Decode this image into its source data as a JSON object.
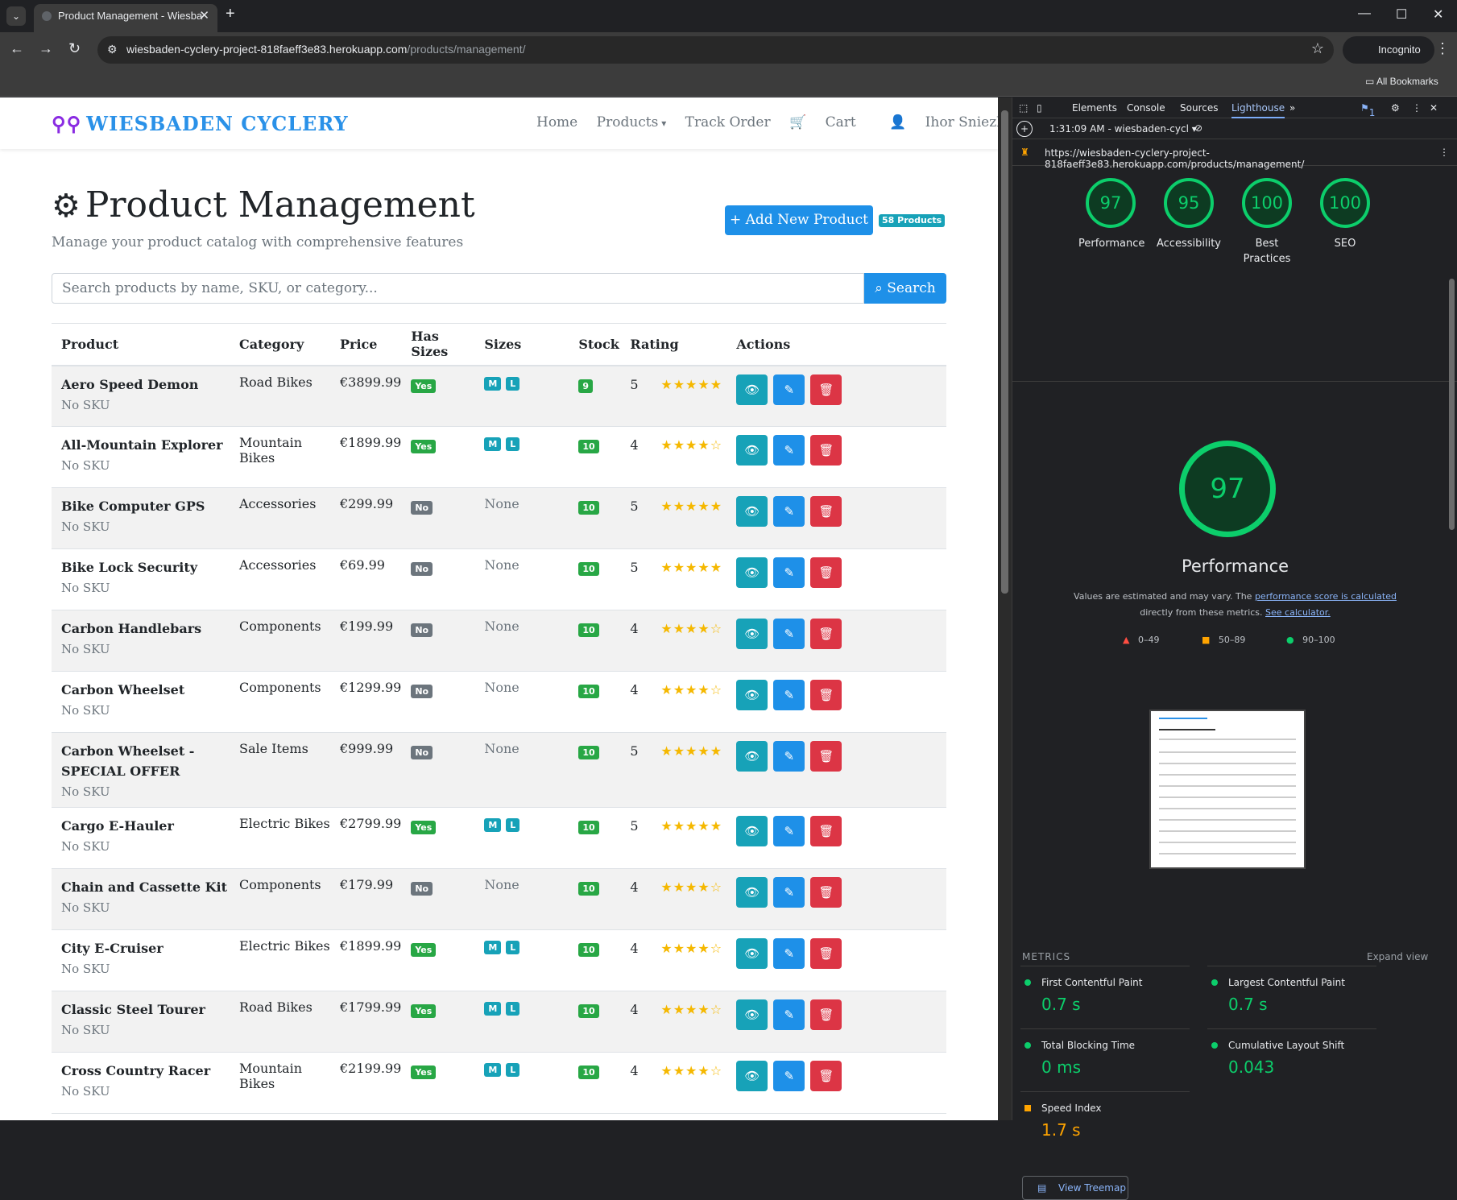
{
  "browser": {
    "tab_title": "Product Management - Wiesba",
    "url_host": "wiesbaden-cyclery-project-818faeff3e83.herokuapp.com",
    "url_path": "/products/management/",
    "incognito_label": "Incognito",
    "bookmarks_label": "All Bookmarks"
  },
  "site": {
    "brand": "WIESBADEN CYCLERY",
    "nav": [
      "Home",
      "Products",
      "Track Order",
      "Cart",
      "Ihor Sniezhko"
    ]
  },
  "header": {
    "title": "Product Management",
    "subtitle": "Manage your product catalog with comprehensive features",
    "add_button": "Add New Product",
    "count_badge": "58 Products"
  },
  "search": {
    "placeholder": "Search products by name, SKU, or category...",
    "button": "Search"
  },
  "table": {
    "columns": [
      "Product",
      "Category",
      "Price",
      "Has Sizes",
      "Sizes",
      "Stock",
      "Rating",
      "Actions"
    ],
    "rows": [
      {
        "name": "Aero Speed Demon",
        "sku": "No SKU",
        "category": "Road Bikes",
        "price": "€3899.99",
        "has_sizes": "Yes",
        "sizes": [
          "M",
          "L"
        ],
        "stock": "9",
        "rating": "5",
        "stars": 5
      },
      {
        "name": "All-Mountain Explorer",
        "sku": "No SKU",
        "category": "Mountain Bikes",
        "price": "€1899.99",
        "has_sizes": "Yes",
        "sizes": [
          "M",
          "L"
        ],
        "stock": "10",
        "rating": "4",
        "stars": 4
      },
      {
        "name": "Bike Computer GPS",
        "sku": "No SKU",
        "category": "Accessories",
        "price": "€299.99",
        "has_sizes": "No",
        "sizes": [],
        "stock": "10",
        "rating": "5",
        "stars": 5
      },
      {
        "name": "Bike Lock Security",
        "sku": "No SKU",
        "category": "Accessories",
        "price": "€69.99",
        "has_sizes": "No",
        "sizes": [],
        "stock": "10",
        "rating": "5",
        "stars": 5
      },
      {
        "name": "Carbon Handlebars",
        "sku": "No SKU",
        "category": "Components",
        "price": "€199.99",
        "has_sizes": "No",
        "sizes": [],
        "stock": "10",
        "rating": "4",
        "stars": 4
      },
      {
        "name": "Carbon Wheelset",
        "sku": "No SKU",
        "category": "Components",
        "price": "€1299.99",
        "has_sizes": "No",
        "sizes": [],
        "stock": "10",
        "rating": "4",
        "stars": 4
      },
      {
        "name": "Carbon Wheelset - SPECIAL OFFER",
        "sku": "No SKU",
        "category": "Sale Items",
        "price": "€999.99",
        "has_sizes": "No",
        "sizes": [],
        "stock": "10",
        "rating": "5",
        "stars": 5
      },
      {
        "name": "Cargo E-Hauler",
        "sku": "No SKU",
        "category": "Electric Bikes",
        "price": "€2799.99",
        "has_sizes": "Yes",
        "sizes": [
          "M",
          "L"
        ],
        "stock": "10",
        "rating": "5",
        "stars": 5
      },
      {
        "name": "Chain and Cassette Kit",
        "sku": "No SKU",
        "category": "Components",
        "price": "€179.99",
        "has_sizes": "No",
        "sizes": [],
        "stock": "10",
        "rating": "4",
        "stars": 4
      },
      {
        "name": "City E-Cruiser",
        "sku": "No SKU",
        "category": "Electric Bikes",
        "price": "€1899.99",
        "has_sizes": "Yes",
        "sizes": [
          "M",
          "L"
        ],
        "stock": "10",
        "rating": "4",
        "stars": 4
      },
      {
        "name": "Classic Steel Tourer",
        "sku": "No SKU",
        "category": "Road Bikes",
        "price": "€1799.99",
        "has_sizes": "Yes",
        "sizes": [
          "M",
          "L"
        ],
        "stock": "10",
        "rating": "4",
        "stars": 4
      },
      {
        "name": "Cross Country Racer",
        "sku": "No SKU",
        "category": "Mountain Bikes",
        "price": "€2199.99",
        "has_sizes": "Yes",
        "sizes": [
          "M",
          "L"
        ],
        "stock": "10",
        "rating": "4",
        "stars": 4
      }
    ],
    "none_label": "None"
  },
  "devtools": {
    "tabs": [
      "Elements",
      "Console",
      "Sources",
      "Lighthouse"
    ],
    "report_time": "1:31:09 AM - wiesbaden-cycl",
    "report_url": "https://wiesbaden-cyclery-project-818faeff3e83.herokuapp.com/products/management/",
    "issues_count": "1",
    "scores": [
      {
        "label": "Performance",
        "value": "97"
      },
      {
        "label": "Accessibility",
        "value": "95"
      },
      {
        "label": "Best Practices",
        "value": "100"
      },
      {
        "label": "SEO",
        "value": "100"
      }
    ],
    "big_score": "97",
    "big_title": "Performance",
    "note_prefix": "Values are estimated and may vary. The ",
    "note_link1": "performance score is calculated",
    "note_mid": " directly from these metrics. ",
    "note_link2": "See calculator.",
    "legend": [
      "0–49",
      "50–89",
      "90–100"
    ],
    "metrics_heading": "METRICS",
    "expand_view": "Expand view",
    "metrics": [
      {
        "name": "First Contentful Paint",
        "value": "0.7 s",
        "status": "green"
      },
      {
        "name": "Largest Contentful Paint",
        "value": "0.7 s",
        "status": "green"
      },
      {
        "name": "Total Blocking Time",
        "value": "0 ms",
        "status": "green"
      },
      {
        "name": "Cumulative Layout Shift",
        "value": "0.043",
        "status": "green"
      },
      {
        "name": "Speed Index",
        "value": "1.7 s",
        "status": "orange"
      }
    ],
    "treemap_button": "View Treemap",
    "colors": {
      "good": "#0cce6b",
      "average": "#ffa400",
      "poor": "#ff4e42"
    }
  }
}
